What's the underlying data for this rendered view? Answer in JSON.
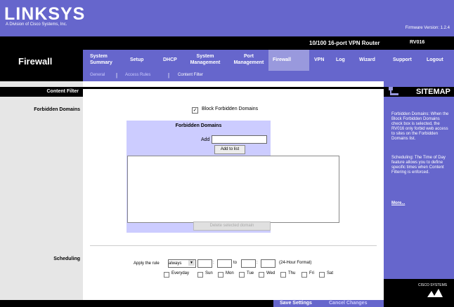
{
  "brand": {
    "logo": "LINKSYS",
    "tagline": "A Division of Cisco Systems, Inc.",
    "firmware": "Firmware Version: 1.2.4"
  },
  "product": {
    "name": "10/100 16-port VPN Router",
    "model": "RV016"
  },
  "page_title": "Firewall",
  "tabs": [
    "System Summary",
    "Setup",
    "DHCP",
    "System Management",
    "Port Management",
    "Firewall",
    "VPN",
    "Log",
    "Wizard",
    "Support",
    "Logout"
  ],
  "subtabs": [
    "General",
    "Access Rules",
    "Content Filter"
  ],
  "section": {
    "label": "Content Filter"
  },
  "forbidden": {
    "label": "Forbidden Domains",
    "checkbox_label": "Block Forbidden Domains",
    "checked": true,
    "panel_title": "Forbidden Domains",
    "add_label": "Add :",
    "add_value": "",
    "add_button": "Add to list",
    "delete_button": "Delete selected domain",
    "domains": []
  },
  "scheduling": {
    "label": "Scheduling",
    "apply_label": "Apply the rule",
    "rule_value": "always",
    "to_label": "to",
    "format_label": "(24-Hour Format)",
    "days": [
      "Everyday",
      "Sun",
      "Mon",
      "Tue",
      "Wed",
      "Thu",
      "Fri",
      "Sat"
    ]
  },
  "sitemap": {
    "title": "SITEMAP",
    "text1": "Forbidden Domains: When the Block Forbidden Domains check box is selected, the RV016 only forbid web access to sites on the Forbidden Domains list.",
    "text2": "Scheduling: The Time of Day feature allows you to define specific times when Content Filtering is enforced.",
    "more": "More..."
  },
  "cisco": "CISCO SYSTEMS",
  "footer": {
    "save": "Save Settings",
    "cancel": "Cancel Changes"
  },
  "colors": {
    "accent": "#6666cc",
    "active_tab": "#9999dd",
    "panel": "#ccccff"
  }
}
